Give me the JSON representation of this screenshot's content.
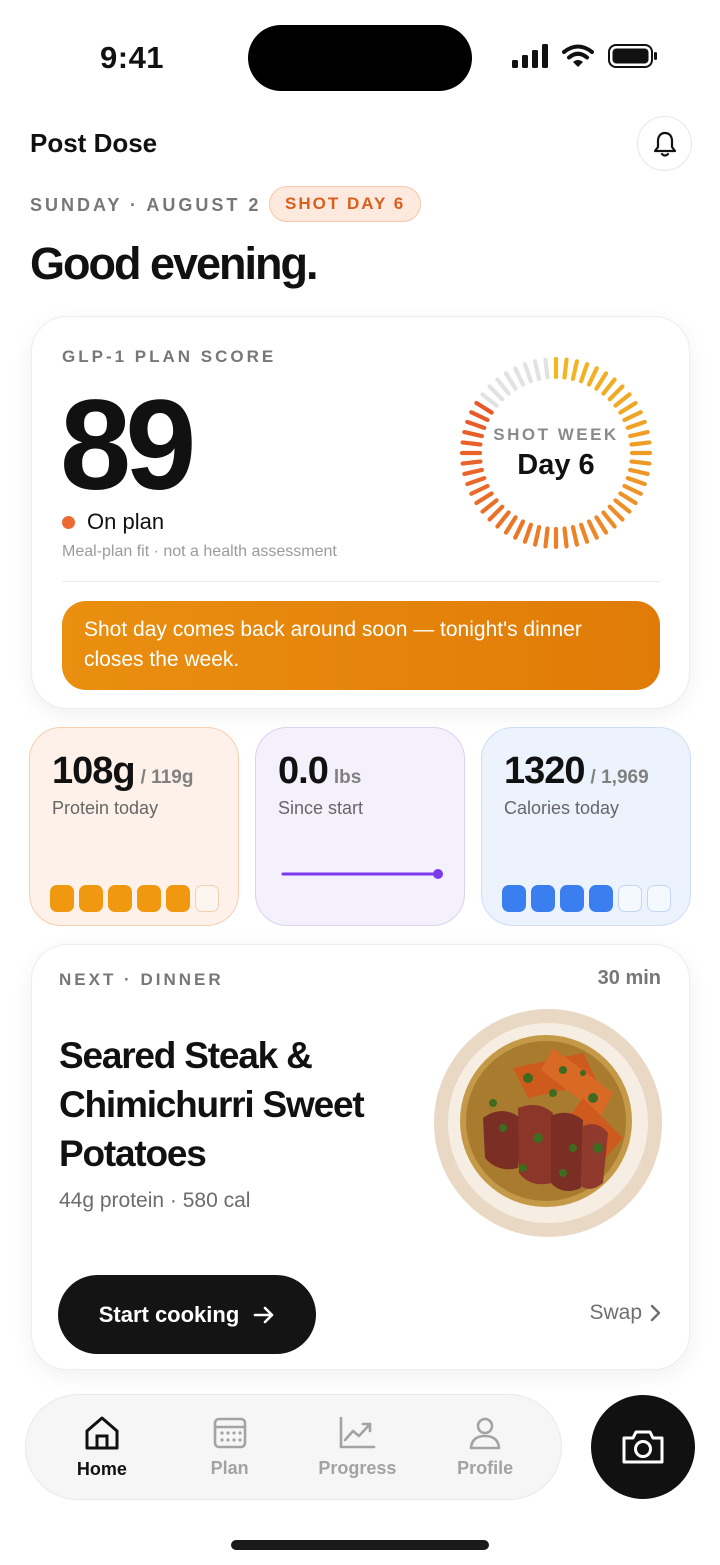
{
  "status_bar": {
    "time": "9:41"
  },
  "header": {
    "app_title": "Post Dose",
    "date": "SUNDAY · AUGUST 2",
    "shot_badge": "SHOT DAY 6",
    "greeting": "Good evening."
  },
  "score_card": {
    "label": "GLP-1 PLAN SCORE",
    "score": "89",
    "status": "On plan",
    "disclaimer": "Meal-plan fit · not a health assessment",
    "ring_label": "SHOT WEEK",
    "ring_day": "Day 6",
    "ring_progress_days": 6,
    "ring_total_days": 7,
    "banner": "Shot day comes back around soon — tonight's dinner closes the week."
  },
  "stats": {
    "protein": {
      "value": "108g",
      "target": "/ 119g",
      "label": "Protein today",
      "filled": 5,
      "total": 6
    },
    "weight": {
      "value": "0.0",
      "unit": "lbs",
      "label": "Since start"
    },
    "calories": {
      "value": "1320",
      "target": "/ 1,969",
      "label": "Calories today",
      "filled": 4,
      "total": 6
    }
  },
  "dinner": {
    "label": "NEXT · DINNER",
    "time": "30 min",
    "title": "Seared Steak & Chimichurri Sweet Potatoes",
    "meta": "44g protein · 580 cal",
    "cook_button": "Start cooking",
    "swap": "Swap"
  },
  "tabs": [
    {
      "label": "Home",
      "icon": "home-icon"
    },
    {
      "label": "Plan",
      "icon": "calendar-icon"
    },
    {
      "label": "Progress",
      "icon": "chart-icon"
    },
    {
      "label": "Profile",
      "icon": "person-icon"
    }
  ],
  "colors": {
    "accent_orange": "#e07b07",
    "badge_orange": "#d8601f",
    "weight_purple": "#7c3aed",
    "calorie_blue": "#3a7ef0"
  }
}
